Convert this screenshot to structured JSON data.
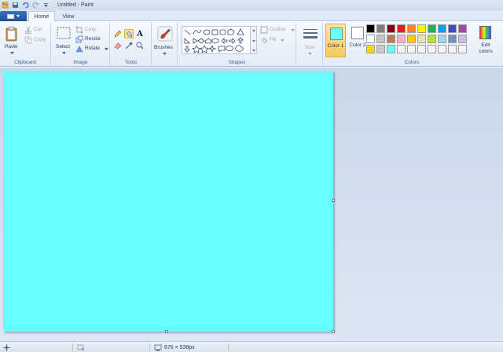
{
  "window": {
    "title": "Untitled - Paint"
  },
  "tabs": [
    {
      "label": "Home",
      "active": true
    },
    {
      "label": "View",
      "active": false
    }
  ],
  "ribbon": {
    "clipboard": {
      "paste": "Paste",
      "cut": "Cut",
      "copy": "Copy",
      "group": "Clipboard"
    },
    "image": {
      "select": "Select",
      "crop": "Crop",
      "resize": "Resize",
      "rotate": "Rotate",
      "group": "Image"
    },
    "tools": {
      "group": "Tools",
      "text_tool": "A"
    },
    "brushes": {
      "label": "Brushes"
    },
    "shapes": {
      "outline": "Outline",
      "fill": "Fill",
      "group": "Shapes"
    },
    "size": {
      "label": "Size"
    },
    "colors": {
      "color1": "Color 1",
      "color2": "Color 2",
      "edit": "Edit colors",
      "group": "Colors",
      "color1_value": "#66ffff",
      "color2_value": "#ffffff",
      "palette_row1": [
        "#000000",
        "#7f7f7f",
        "#880015",
        "#ed1c24",
        "#ff7f27",
        "#fff200",
        "#22b14c",
        "#00a2e8",
        "#3f48cc",
        "#a349a4"
      ],
      "palette_row2": [
        "#ffffff",
        "#c3c3c3",
        "#b97a57",
        "#ffaec9",
        "#ffc90e",
        "#efe4b0",
        "#b5e61d",
        "#99d9ea",
        "#7092be",
        "#c8bfe7"
      ],
      "palette_row3": [
        "#ffd700",
        "#c8c8c8",
        "#66ffff",
        "#f4f4f4",
        "#f4f4f4",
        "#f4f4f4",
        "#f4f4f4",
        "#f4f4f4",
        "#f4f4f4",
        "#f4f4f4"
      ]
    }
  },
  "canvas": {
    "fill_color": "#66ffff"
  },
  "status": {
    "dimensions": "676 × 538px"
  }
}
